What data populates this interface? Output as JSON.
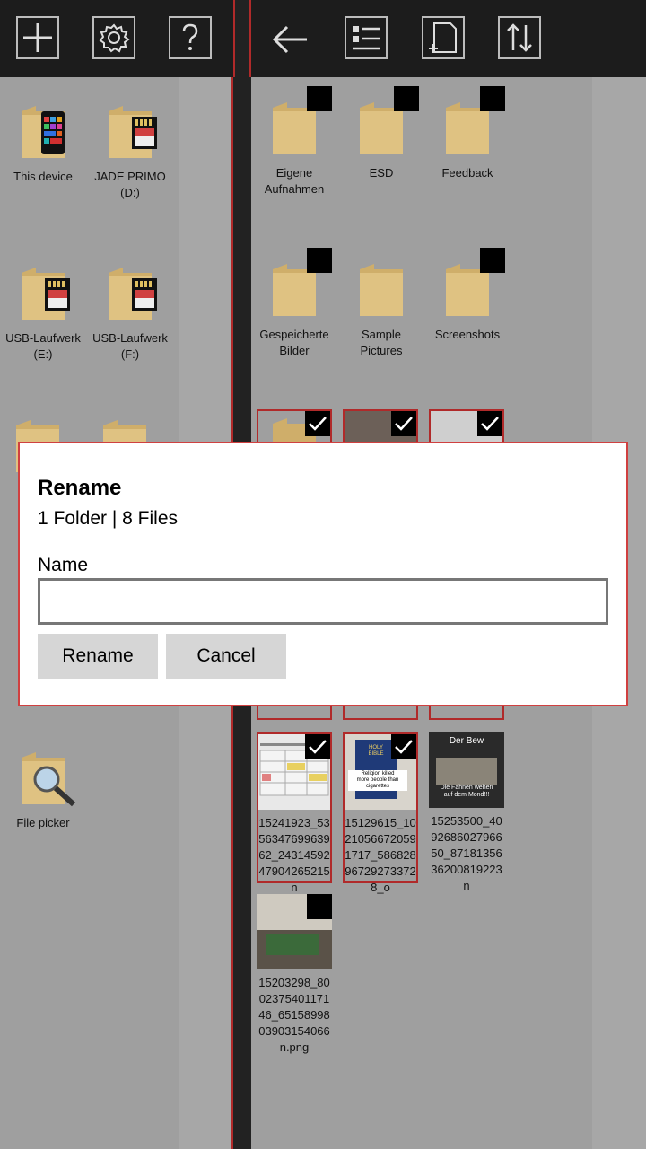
{
  "toolbar_left": {
    "buttons": [
      {
        "name": "add-icon"
      },
      {
        "name": "gear-icon"
      },
      {
        "name": "help-icon"
      }
    ]
  },
  "toolbar_right": {
    "buttons": [
      {
        "name": "back-arrow-icon"
      },
      {
        "name": "list-view-icon"
      },
      {
        "name": "new-file-icon"
      },
      {
        "name": "sort-icon"
      }
    ]
  },
  "left_pane": {
    "items": [
      {
        "label": "This device",
        "icon": "phone-icon"
      },
      {
        "label": "JADE PRIMO\n(D:)",
        "icon": "sd-card-icon"
      },
      {
        "label": "USB-Laufwerk\n(E:)",
        "icon": "sd-card-icon"
      },
      {
        "label": "USB-Laufwerk\n(F:)",
        "icon": "sd-card-icon"
      },
      {
        "label": "File picker",
        "icon": "magnifier-icon"
      }
    ]
  },
  "right_pane": {
    "folders": [
      {
        "label": "Eigene\nAufnahmen"
      },
      {
        "label": "ESD"
      },
      {
        "label": "Feedback"
      },
      {
        "label": "Gespeicherte\nBilder"
      },
      {
        "label": "Sample\nPictures"
      },
      {
        "label": "Screenshots"
      }
    ],
    "files": [
      {
        "name": "15241923_53\n56347699639\n62_24314592\n47904265215\nn",
        "selected": true
      },
      {
        "name": "15129615_10\n21056672059\n1717_586828\n96729273372\n8_o",
        "selected": true
      },
      {
        "name": "15253500_40\n92686027966\n50_87181356\n36200819223\nn",
        "selected": false
      },
      {
        "name": "15203298_80\n02375401171\n46_65158998\n03903154066\nn.png",
        "selected": false
      }
    ],
    "thumb_texts": {
      "bible_badge": "HOLY\nBIBLE",
      "bible_caption": "Religion killed\nmore people than\ncigarettes",
      "moon_top": "Der Bew",
      "moon_bottom": "Die Fahnen wehen\nauf dem Mond!!!"
    }
  },
  "dialog": {
    "title": "Rename",
    "subtitle": "1 Folder | 8 Files",
    "name_label": "Name",
    "name_value": "",
    "rename_button": "Rename",
    "cancel_button": "Cancel"
  }
}
